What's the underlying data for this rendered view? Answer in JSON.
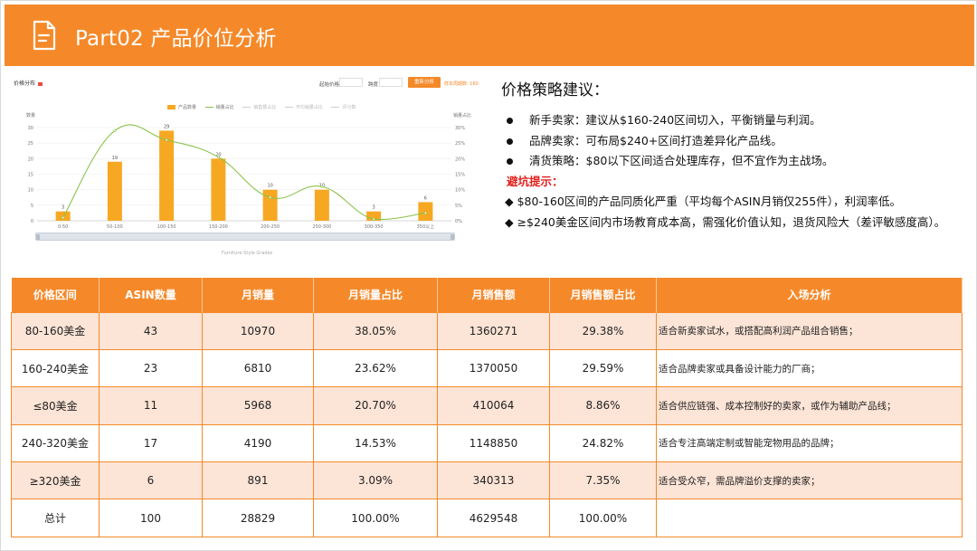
{
  "header": {
    "title": "Part02 产品价位分析",
    "icon": "document-icon"
  },
  "chart_panel": {
    "label": "价格分布",
    "start_price_label": "起始价格",
    "step_label": "跨度",
    "button_label": "重新分析",
    "hint": "样本周期数: 160",
    "caption": "Furniture-Style Grades"
  },
  "chart_data": {
    "type": "bar",
    "categories": [
      "0-50",
      "50-100",
      "100-150",
      "150-200",
      "200-250",
      "250-300",
      "300-350",
      "350以上"
    ],
    "series": [
      {
        "name": "产品数量",
        "type": "bar",
        "axis": "left",
        "color": "#F7A823",
        "values": [
          3,
          19,
          29,
          20,
          10,
          10,
          3,
          6
        ]
      },
      {
        "name": "销量占比",
        "type": "line",
        "axis": "right",
        "color": "#8BC34A",
        "values": [
          1.0,
          29.0,
          26.0,
          20.5,
          7.5,
          11.0,
          0.5,
          2.5
        ]
      }
    ],
    "legend": [
      "产品数量",
      "销量占比",
      "销售额占比",
      "平均销量占比",
      "评分数"
    ],
    "ylabel_left": "数量",
    "ylabel_right": "销量占比",
    "left_ticks": [
      "0",
      "5",
      "10",
      "15",
      "20",
      "25",
      "30"
    ],
    "right_ticks": [
      "0%",
      "5%",
      "10%",
      "15%",
      "20%",
      "25%",
      "30%"
    ],
    "ylim_left": [
      0,
      30
    ],
    "ylim_right": [
      0,
      30
    ],
    "legend_position": "top-center",
    "grid": true
  },
  "strategy": {
    "title": "价格策略建议：",
    "bullets": [
      "新手卖家：建议从$160-240区间切入，平衡销量与利润。",
      "品牌卖家：可布局$240+区间打造差异化产品线。",
      "清货策略：$80以下区间适合处理库存，但不宜作为主战场。"
    ],
    "warning_title": "避坑提示：",
    "warnings": [
      "◆ $80-160区间的产品同质化严重（平均每个ASIN月销仅255件），利润率低。",
      "◆ ≥$240美金区间内市场教育成本高，需强化价值认知，退货风险大（差评敏感度高）。"
    ]
  },
  "table": {
    "headers": [
      "价格区间",
      "ASIN数量",
      "月销量",
      "月销量占比",
      "月销售额",
      "月销售额占比",
      "入场分析"
    ],
    "rows": [
      [
        "80-160美金",
        "43",
        "10970",
        "38.05%",
        "1360271",
        "29.38%",
        "适合新卖家试水，或搭配高利润产品组合销售；"
      ],
      [
        "160-240美金",
        "23",
        "6810",
        "23.62%",
        "1370050",
        "29.59%",
        "适合品牌卖家或具备设计能力的厂商；"
      ],
      [
        "≤80美金",
        "11",
        "5968",
        "20.70%",
        "410064",
        "8.86%",
        "适合供应链强、成本控制好的卖家，或作为辅助产品线；"
      ],
      [
        "240-320美金",
        "17",
        "4190",
        "14.53%",
        "1148850",
        "24.82%",
        "适合专注高端定制或智能宠物用品的品牌；"
      ],
      [
        "≥320美金",
        "6",
        "891",
        "3.09%",
        "340313",
        "7.35%",
        "适合受众窄，需品牌溢价支撑的卖家；"
      ],
      [
        "总计",
        "100",
        "28829",
        "100.00%",
        "4629548",
        "100.00%",
        ""
      ]
    ]
  },
  "colors": {
    "accent": "#F5892A",
    "row_shade": "#FCE4D6",
    "warning": "#e0201c",
    "bar": "#F7A823",
    "line": "#8BC34A"
  }
}
